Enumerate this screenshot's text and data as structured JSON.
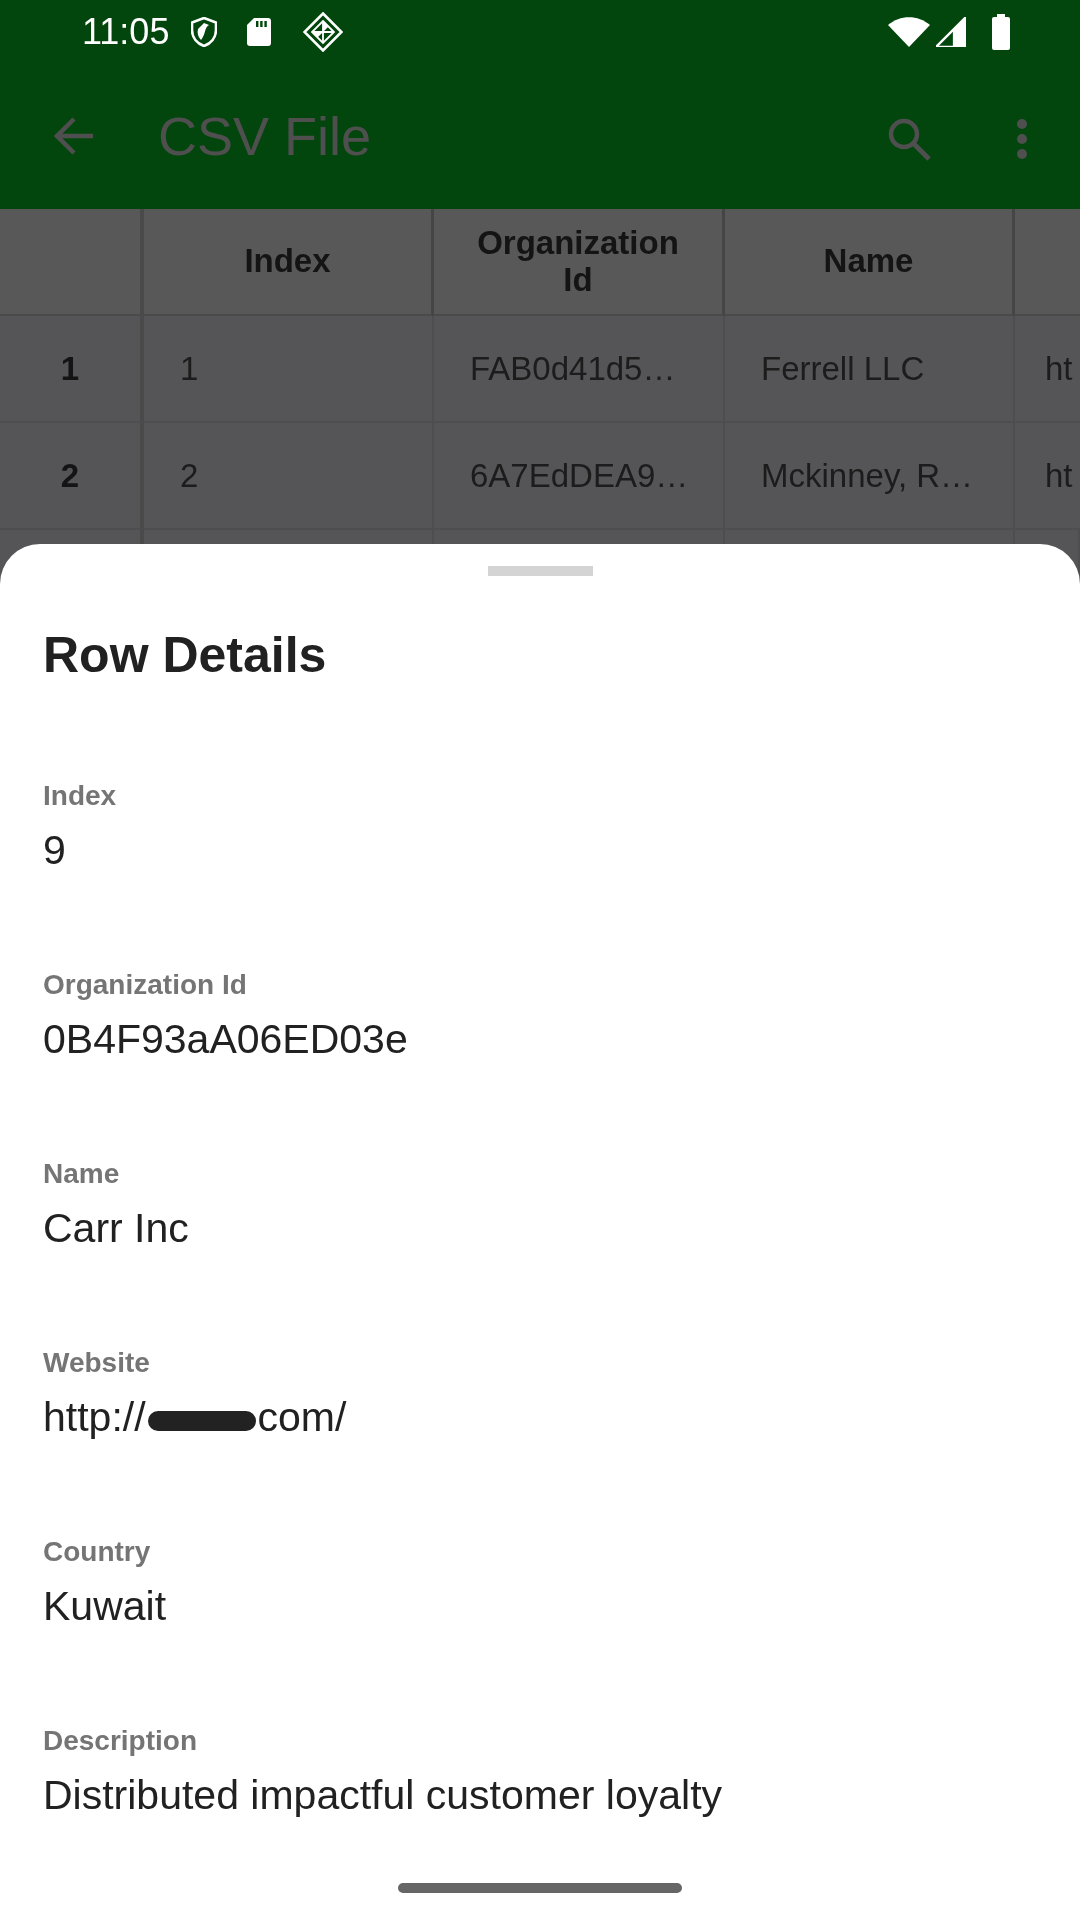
{
  "status_bar": {
    "time": "11:05"
  },
  "app_bar": {
    "title": "CSV File"
  },
  "table": {
    "columns": [
      "Index",
      "Organization Id",
      "Name"
    ],
    "rows": [
      {
        "number": "1",
        "cells": [
          "1",
          "FAB0d41d5…",
          "Ferrell LLC",
          "ht"
        ]
      },
      {
        "number": "2",
        "cells": [
          "2",
          "6A7EdDEA9…",
          "Mckinney, R…",
          "ht"
        ]
      }
    ]
  },
  "sheet": {
    "title": "Row Details",
    "fields": [
      {
        "label": "Index",
        "value": "9"
      },
      {
        "label": "Organization Id",
        "value": "0B4F93aA06ED03e"
      },
      {
        "label": "Name",
        "value": "Carr Inc"
      },
      {
        "label": "Website",
        "value": "http://",
        "redacted": true,
        "value_end": "com/"
      },
      {
        "label": "Country",
        "value": "Kuwait"
      },
      {
        "label": "Description",
        "value": "Distributed impactful customer loyalty"
      }
    ]
  }
}
